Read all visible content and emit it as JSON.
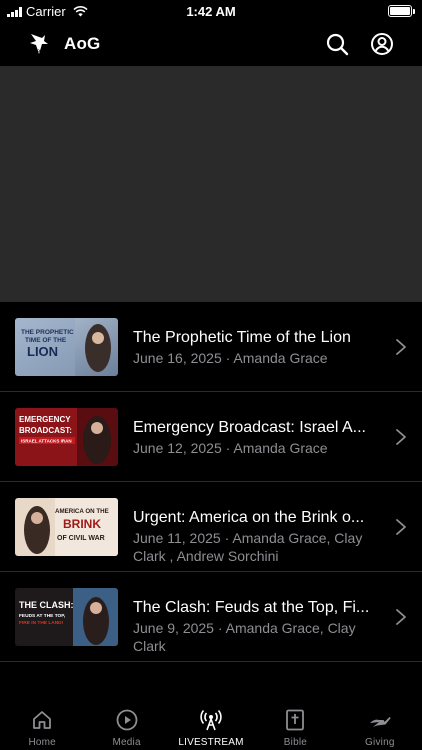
{
  "status_bar": {
    "carrier": "Carrier",
    "time": "1:42 AM"
  },
  "header": {
    "title": "AoG",
    "logo_text": "AOG"
  },
  "episodes": [
    {
      "title": "The Prophetic Time of the Lion",
      "meta": "June 16, 2025 · Amanda Grace",
      "thumb": {
        "line1": "THE PROPHETIC",
        "line2": "TIME OF THE",
        "line3": "LION"
      }
    },
    {
      "title": "Emergency Broadcast: Israel A...",
      "meta": "June 12, 2025 · Amanda Grace",
      "thumb": {
        "line1": "EMERGENCY",
        "line2": "BROADCAST:",
        "line3": "ISRAEL ATTACKS IRAN"
      }
    },
    {
      "title": "Urgent: America on the Brink o...",
      "meta": "June 11, 2025 · Amanda Grace, Clay Clark , Andrew Sorchini",
      "thumb": {
        "line1": "AMERICA ON THE",
        "line2": "BRINK",
        "line3": "OF CIVIL WAR"
      }
    },
    {
      "title": "The Clash: Feuds at the Top, Fi...",
      "meta": "June 9, 2025 · Amanda Grace, Clay Clark",
      "thumb": {
        "line1": "THE CLASH:",
        "line2": "FEUDS AT THE TOP,",
        "line3": "FIRE IN THE LAND!"
      }
    }
  ],
  "tabs": [
    {
      "label": "Home",
      "icon": "home-icon",
      "active": false
    },
    {
      "label": "Media",
      "icon": "play-circle-icon",
      "active": false
    },
    {
      "label": "LIVESTREAM",
      "icon": "broadcast-antenna-icon",
      "active": true
    },
    {
      "label": "Bible",
      "icon": "bible-cross-icon",
      "active": false
    },
    {
      "label": "Giving",
      "icon": "giving-hand-icon",
      "active": false
    }
  ],
  "colors": {
    "background": "#000000",
    "player": "#2a2a2a",
    "secondary_text": "#8e8e93",
    "divider": "#2b2b2b"
  }
}
